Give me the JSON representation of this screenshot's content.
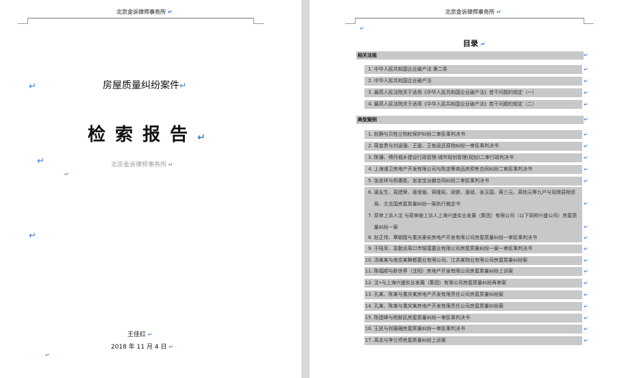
{
  "left_page": {
    "header": "北京金诉律师事务所",
    "title": "房屋质量纠纷案件",
    "report_title": "检索报告",
    "firm": "北京金诉律师事务所",
    "author": "王佳红",
    "date": "2018 年 11 月 4 日"
  },
  "right_page": {
    "header": "北京金诉律师事务所",
    "toc_title": "目录",
    "sections": [
      {
        "heading": "相关法规",
        "items": [
          {
            "num": "1.",
            "text": "中华人民共和国企业破产法 第二条"
          },
          {
            "num": "2.",
            "text": "中华人民共和国企业破产法"
          },
          {
            "num": "3.",
            "text": "最高人民法院关于适用《中华人民共和国企业破产法》若干问题的规定（一）"
          },
          {
            "num": "4.",
            "text": "最高人民法院关于适用《中华人民共和国企业破产法》若干问题的规定（二）"
          }
        ]
      },
      {
        "heading": "典型案例",
        "items": [
          {
            "num": "1.",
            "text": "赵静与贝桂兰物权保护纠纷二审民事判决书"
          },
          {
            "num": "2.",
            "text": "蒋金贵与刘运强、王骏、王勃返还原物纠纷一审民事判决书"
          },
          {
            "num": "3.",
            "text": "陈骥、傅丹城乡建设行政管理:城市规划管理(规划)二审行政判决书"
          },
          {
            "num": "4.",
            "text": "上海浦卫房地产开发有限公司与陈忠等商品房预售合同纠纷二审民事判决书"
          },
          {
            "num": "5.",
            "text": "张金祥与杨惠胜、张金宝派撤合同纠纷二审民事判决书"
          },
          {
            "num": "6.",
            "text": "唐友生、周建荣、唐增循、蒋隆拓、胡健、唐斌、张玉国、蒋三元、周柏元等九户与双牌县物资局、文志国房屋质量纠纷一案执行裁定书"
          },
          {
            "num": "7.",
            "text": "原审上诉人沈 与原审被上诉人上海兴盛实业发展（集团）有限公司（以下简称兴盛公司）房屋质量纠纷一案"
          },
          {
            "num": "8.",
            "text": "赵正伟、覃朝霞与重庆豪安房地产开发有限公司房屋质量纠纷一审民事判决书"
          },
          {
            "num": "9.",
            "text": "于陆军、袁勤诉周口市锦藻置业有限公司房屋质量纠纷一案一审民事判决书"
          },
          {
            "num": "10.",
            "text": "汤某某与南京某舞都置业有限公司、江苏某物业有限公司房屋质量纠纷案"
          },
          {
            "num": "11.",
            "text": "陈福顺与新世界（沈阳）房地产开发有限公司房屋质量纠纷上诉案"
          },
          {
            "num": "12.",
            "text": "沈•与上海兴盛实业发展（集团）有限公司房屋质量纠纷再审案"
          },
          {
            "num": "13.",
            "text": "孔某、陈某与重庆某房地产开发有限责任公司房屋质量纠纷案"
          },
          {
            "num": "14.",
            "text": "孔某、陈某与重庆某房地产开发有限责任公司房屋质量纠纷案"
          },
          {
            "num": "15.",
            "text": "陈建峰与杨新民房屋质量纠纷一审民事判决书"
          },
          {
            "num": "16.",
            "text": "王凯与何珊珊房屋质量纠纷一审民事判决书"
          },
          {
            "num": "17.",
            "text": "周志与李兰停房屋质量纠纷上诉案"
          }
        ]
      }
    ]
  },
  "colors": {
    "paragraph_mark": "#3a7bd5",
    "toc_highlight": "#c8c8c8"
  }
}
